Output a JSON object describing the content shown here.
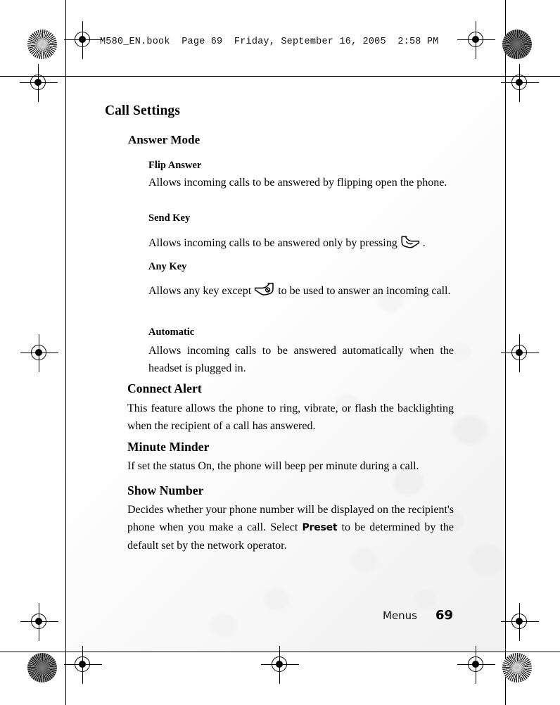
{
  "slug": {
    "text": "M580_EN.book  Page 69  Friday, September 16, 2005  2:58 PM",
    "filename": "M580_EN.book",
    "page_label": "Page 69",
    "date": "Friday, September 16, 2005",
    "time": "2:58 PM"
  },
  "page": {
    "title": "Call Settings",
    "section_heading": "Answer Mode"
  },
  "answer_mode": {
    "items": [
      {
        "term": "Flip Answer",
        "text": "Allows incoming calls to be answered by flipping open the phone."
      },
      {
        "term": "Send Key",
        "text_before": "Allows incoming calls to be answered only by pressing",
        "icon": "send-key-icon",
        "text_after": "."
      },
      {
        "term": "Any Key",
        "text_before": "Allows any key except",
        "icon": "end-key-icon",
        "text_after": "to be used to answer an incoming call."
      },
      {
        "term": "Automatic",
        "text": "Allows incoming calls to be answered automatically when the headset is plugged in."
      }
    ]
  },
  "sections": [
    {
      "heading": "Connect Alert",
      "text": "This feature allows the phone to ring, vibrate, or flash the backlighting when the recipient of a call has answered."
    },
    {
      "heading": "Minute Minder",
      "text": "If set the status On, the phone will beep per minute during a call."
    },
    {
      "heading": "Show Number",
      "text_before": "Decides whether your phone number will be displayed on the recipient's phone when you make a call. Select",
      "emphasis": "Preset",
      "text_after": "to be determined by the default set by the network operator."
    }
  ],
  "footer": {
    "label": "Menus",
    "page_number": "69"
  },
  "colors": {
    "ink": "#000000",
    "paper": "#ffffff",
    "watermark": "#f0f0f0"
  }
}
